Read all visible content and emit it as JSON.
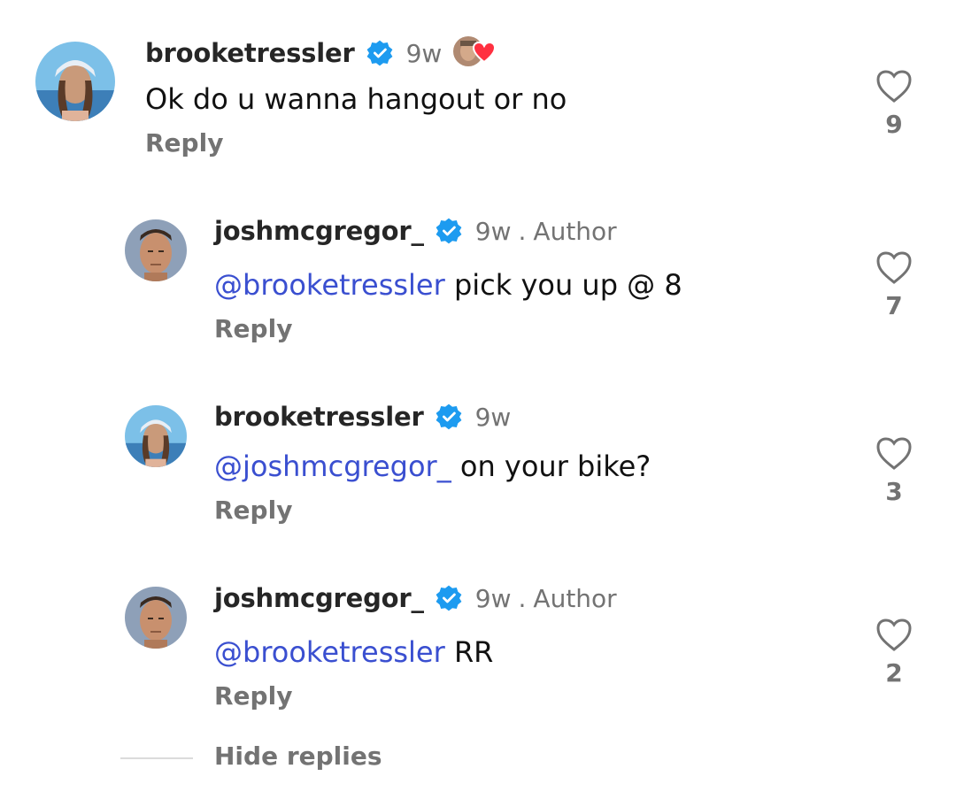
{
  "comments": [
    {
      "username": "brooketressler",
      "time": "9w",
      "author": "",
      "mention": "",
      "text": "Ok do u wanna hangout or no",
      "reply": "Reply",
      "likes": "9",
      "avatar": "woman-avatar",
      "reaction": "liked-by-creator-heart-icon"
    },
    {
      "username": "joshmcgregor_",
      "time": "9w",
      "dot": ".",
      "author": "Author",
      "mention": "@brooketressler",
      "text": " pick you up @ 8",
      "reply": "Reply",
      "likes": "7",
      "avatar": "man-avatar"
    },
    {
      "username": "brooketressler",
      "time": "9w",
      "author": "",
      "mention": "@joshmcgregor_",
      "text": " on your bike?",
      "reply": "Reply",
      "likes": "3",
      "avatar": "woman-avatar"
    },
    {
      "username": "joshmcgregor_",
      "time": "9w",
      "dot": ".",
      "author": "Author",
      "mention": "@brooketressler",
      "text": " RR",
      "reply": "Reply",
      "likes": "2",
      "avatar": "man-avatar"
    }
  ],
  "hide_replies": "Hide replies",
  "colors": {
    "mention": "#3a4fd0",
    "verified": "#1d9bf0",
    "muted": "#737373",
    "heart_red": "#ff3040"
  }
}
